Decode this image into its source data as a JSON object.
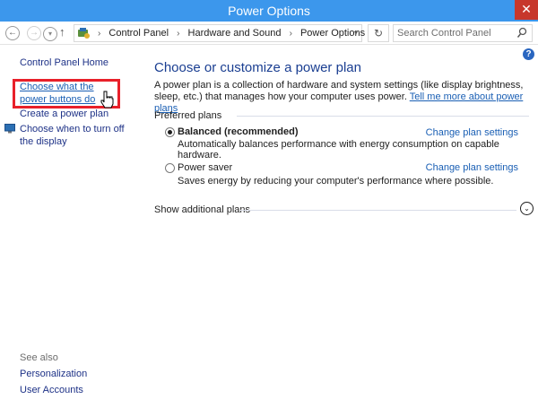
{
  "window": {
    "title": "Power Options",
    "close_glyph": "✕"
  },
  "nav": {
    "back_glyph": "←",
    "forward_glyph": "→",
    "up_glyph": "↑",
    "refresh_glyph": "↻",
    "breadcrumb": [
      "Control Panel",
      "Hardware and Sound",
      "Power Options"
    ],
    "search_placeholder": "Search Control Panel"
  },
  "left_pane": {
    "home": "Control Panel Home",
    "power_buttons": "Choose what the power buttons do",
    "create_plan": "Create a power plan",
    "turn_off_display": "Choose when to turn off the display",
    "see_also_label": "See also",
    "see_also": [
      "Personalization",
      "User Accounts"
    ]
  },
  "main": {
    "help_glyph": "?",
    "heading": "Choose or customize a power plan",
    "description": "A power plan is a collection of hardware and system settings (like display brightness, sleep, etc.) that manages how your computer uses power.",
    "description_link": "Tell me more about power plans",
    "preferred_label": "Preferred plans",
    "plans": [
      {
        "name": "Balanced (recommended)",
        "selected": true,
        "description": "Automatically balances performance with energy consumption on capable hardware.",
        "link": "Change plan settings"
      },
      {
        "name": "Power saver",
        "selected": false,
        "description": "Saves energy by reducing your computer's performance where possible.",
        "link": "Change plan settings"
      }
    ],
    "additional_label": "Show additional plans",
    "expand_glyph": "⌄"
  },
  "icons": {
    "control_panel": "control-panel-icon",
    "search": "search-icon",
    "display": "display-icon",
    "cursor": "hand-cursor-icon"
  },
  "colors": {
    "titlebar": "#3c97ec",
    "close": "#c7372b",
    "link": "#1a5fb4",
    "heading": "#1a3e91",
    "highlight": "#e8202a"
  }
}
